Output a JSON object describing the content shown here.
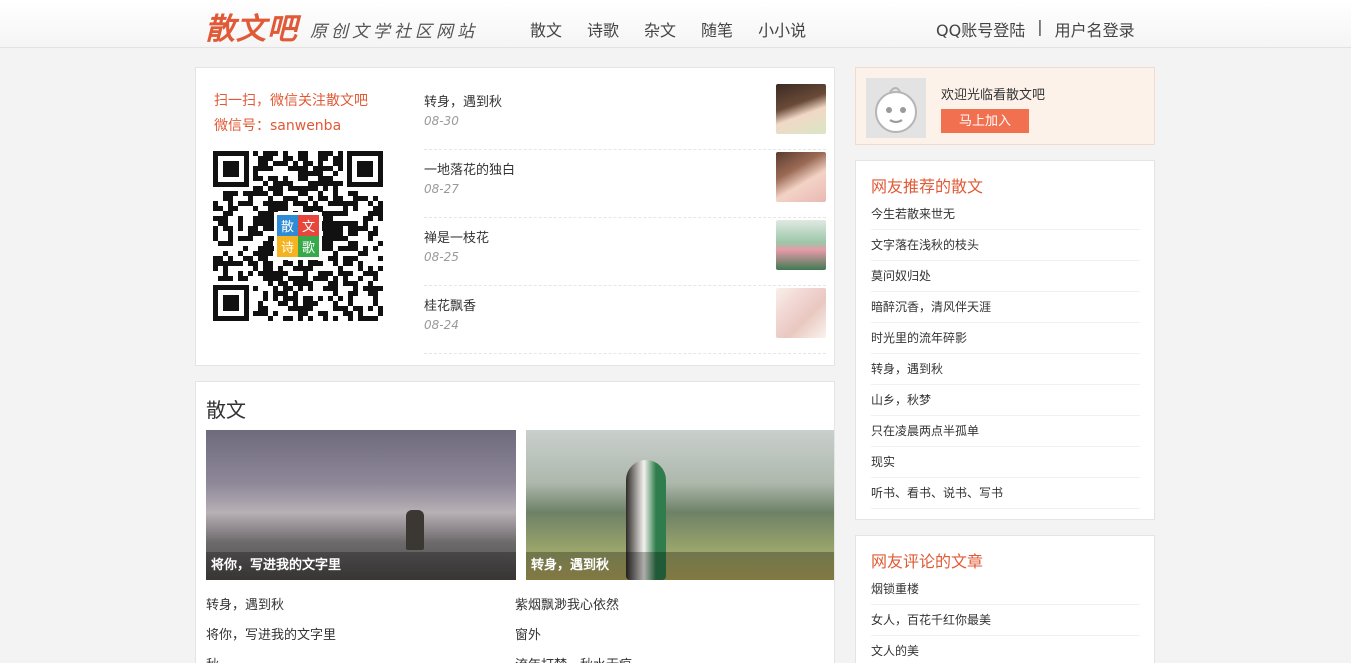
{
  "header": {
    "logo": "散文吧",
    "slogan": "原创文学社区网站",
    "nav": [
      "散文",
      "诗歌",
      "杂文",
      "随笔",
      "小小说"
    ],
    "login_qq": "QQ账号登陆",
    "separator": "|",
    "login_user": "用户名登录"
  },
  "qr": {
    "title": "扫一扫，微信关注散文吧",
    "wechat": "微信号：sanwenba",
    "center_chars": [
      "散",
      "文",
      "诗",
      "歌"
    ]
  },
  "news": [
    {
      "title": "转身，遇到秋",
      "date": "08-30"
    },
    {
      "title": "一地落花的独白",
      "date": "08-27"
    },
    {
      "title": "禅是一枝花",
      "date": "08-25"
    },
    {
      "title": "桂花飘香",
      "date": "08-24"
    }
  ],
  "prose": {
    "title": "散文",
    "features": [
      {
        "caption": "将你，写进我的文字里"
      },
      {
        "caption": "转身，遇到秋"
      }
    ],
    "left_list": [
      "转身，遇到秋",
      "将你，写进我的文字里",
      "秋"
    ],
    "right_list": [
      "紫烟飘渺我心依然",
      "窗外",
      "流年打梦，秋水无痕"
    ]
  },
  "welcome": {
    "text": "欢迎光临看散文吧",
    "button": "马上加入"
  },
  "recommended": {
    "title": "网友推荐的散文",
    "items": [
      "今生若散来世无",
      "文字落在浅秋的枝头",
      "莫问奴归处",
      "暗醉沉香，清风伴天涯",
      "时光里的流年碎影",
      "转身，遇到秋",
      "山乡，秋梦",
      "只在凌晨两点半孤单",
      "现实",
      "听书、看书、说书、写书"
    ]
  },
  "commented": {
    "title": "网友评论的文章",
    "items": [
      "烟锁重楼",
      "女人，百花千红你最美",
      "文人的美"
    ]
  }
}
